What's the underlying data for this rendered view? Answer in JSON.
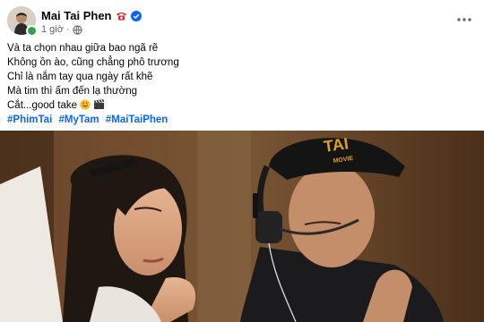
{
  "post": {
    "author_name": "Mai Tai Phen",
    "timestamp": "1 giờ",
    "privacy_icon": "globe-icon",
    "badge_icons": [
      "telephone-icon",
      "verified-badge-icon"
    ],
    "caption_lines": [
      "Và ta chọn nhau giữa bao ngã rẽ",
      "Không ồn ào, cũng chẳng phô trương",
      "Chỉ là nắm tay qua ngày rất khẽ",
      "Mà tim thì ấm đến lạ thường",
      "Cắt...good take"
    ],
    "caption_emojis": [
      "smiling-face-icon",
      "clapper-board-icon"
    ],
    "hashtags": [
      "#PhimTai",
      "#MyTam",
      "#MaiTaiPhen"
    ],
    "more_options_icon": "more-horizontal-icon",
    "photo": {
      "description_icon": "post-photo",
      "cap_text_top": "TAI",
      "cap_text_bottom": "MOVIE"
    }
  },
  "colors": {
    "hashtag": "#0866ff",
    "secondary_text": "#65676b",
    "online": "#31a24c",
    "verified": "#0866ff",
    "phone": "#d32f2f"
  }
}
